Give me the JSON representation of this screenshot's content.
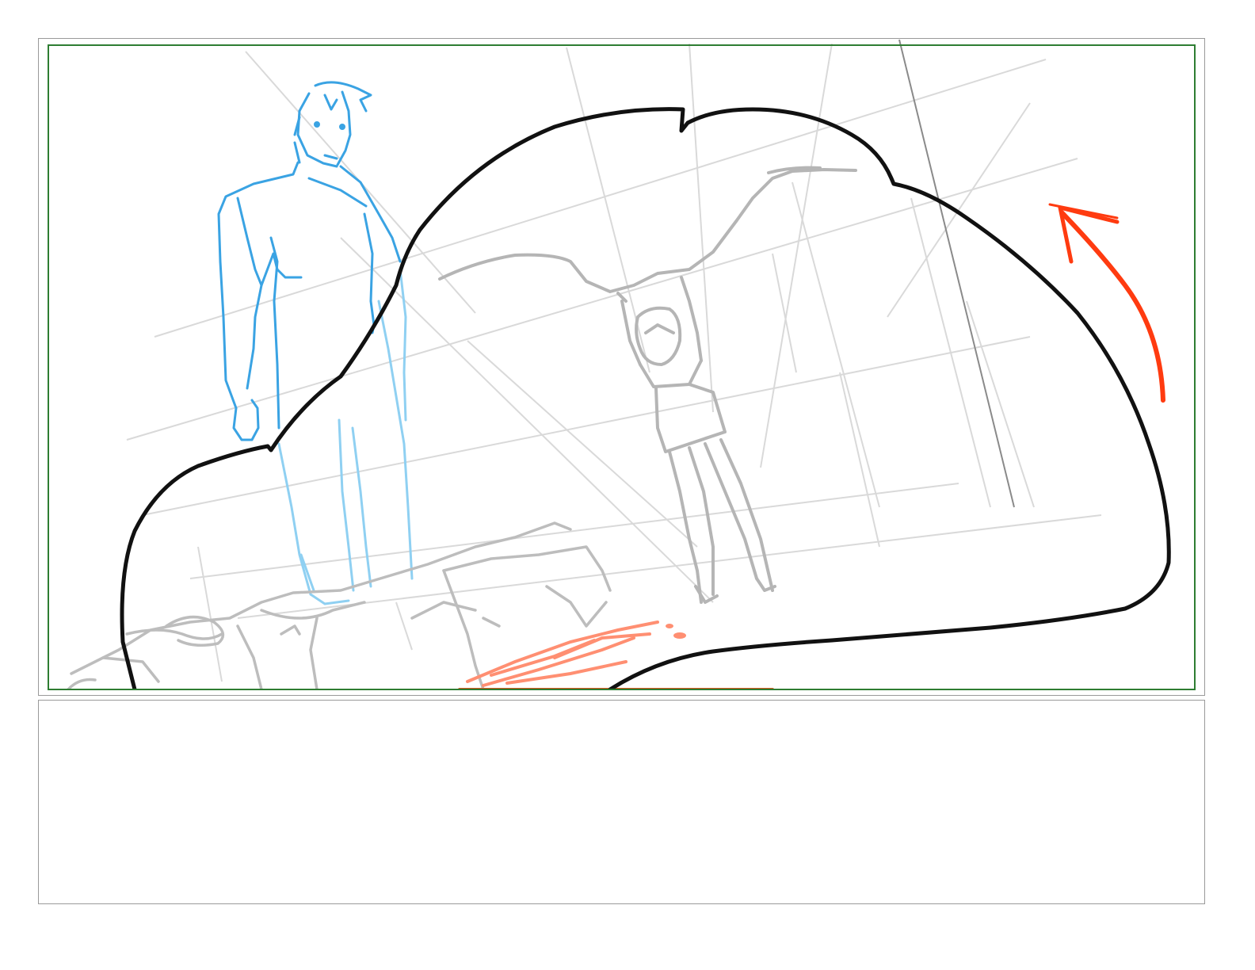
{
  "storyboard": {
    "panel": {
      "stroke_colors": {
        "frame": "#9a9a9a",
        "safe_area": "#2e7d32",
        "ink": "#111111",
        "rough_blue": "#3aa3e3",
        "rough_blue_light": "#8fd0f2",
        "rough_gray": "#b0b0b0",
        "construction_lines": "#d6d6d6",
        "motion_arrow": "#ff3b10",
        "blood": "#ff8c6e"
      },
      "layers": [
        "construction-lines",
        "rough-blue-figure",
        "rough-gray-figures",
        "ink-outline",
        "motion-arrow"
      ]
    },
    "notes": {
      "text": ""
    }
  }
}
